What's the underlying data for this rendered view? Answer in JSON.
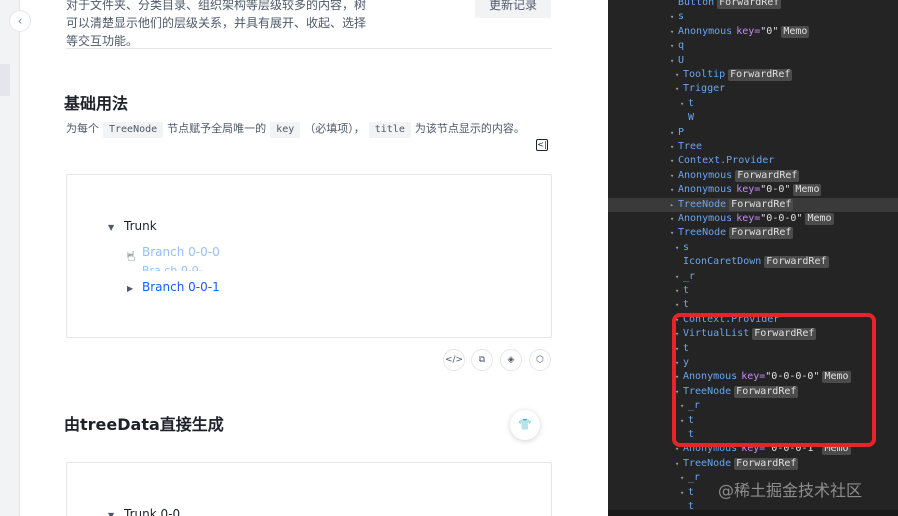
{
  "left_nav": {
    "collapse_icon": "chevron-left-icon",
    "collapse_glyph": "‹"
  },
  "doc": {
    "intro": "对于文件夹、分类目录、组织架构等层级较多的内容，树可以清楚显示他们的层级关系，并具有展开、收起、选择等交互功能。",
    "changelog_label": "更新记录",
    "section1": {
      "title": "基础用法",
      "desc_1": "为每个",
      "code_1": "TreeNode",
      "desc_2": "节点赋予全局唯一的",
      "code_2": "key",
      "desc_3": "（必填项），",
      "code_3": "title",
      "desc_4": "为该节点显示的内容。",
      "demo": {
        "root_label": "Trunk",
        "branch_1": "Branch 0-0-0",
        "branch_1_overlap": "Bra ch 0-0-",
        "branch_2": "Branch 0-0-1"
      },
      "toolbar_icons": [
        "code-icon",
        "copy-icon",
        "codepen-icon",
        "codesandbox-icon"
      ],
      "toolbar_glyphs": [
        "</>",
        "⧉",
        "◈",
        "⬡"
      ]
    },
    "section2": {
      "title": "由treeData直接生成",
      "demo_root_label": "Trunk 0-0"
    },
    "float_icon": "shirt-icon",
    "float_glyph": "👕",
    "expand_code_glyph": "<|"
  },
  "devtools": {
    "rows": [
      {
        "indent": 0,
        "arrow": "",
        "name": "Button",
        "badges": [
          "ForwardRef"
        ]
      },
      {
        "indent": 0,
        "arrow": "▾",
        "name": "s",
        "badges": []
      },
      {
        "indent": 0,
        "arrow": "▾",
        "name": "Anonymous",
        "key": "\"0\"",
        "badges": [
          "Memo"
        ]
      },
      {
        "indent": 0,
        "arrow": "▾",
        "name": "q",
        "badges": []
      },
      {
        "indent": 0,
        "arrow": "▾",
        "name": "U",
        "badges": []
      },
      {
        "indent": 1,
        "arrow": "▾",
        "name": "Tooltip",
        "badges": [
          "ForwardRef"
        ]
      },
      {
        "indent": 1,
        "arrow": "▾",
        "name": "Trigger",
        "badges": []
      },
      {
        "indent": 2,
        "arrow": "▾",
        "name": "t",
        "badges": []
      },
      {
        "indent": 2,
        "arrow": "",
        "name": "W",
        "badges": []
      },
      {
        "indent": 0,
        "arrow": "▾",
        "name": "P",
        "badges": []
      },
      {
        "indent": 0,
        "arrow": "▾",
        "name": "Tree",
        "badges": []
      },
      {
        "indent": 0,
        "arrow": "▾",
        "name": "Context.Provider",
        "badges": []
      },
      {
        "indent": 0,
        "arrow": "▾",
        "name": "Anonymous",
        "badges": [
          "ForwardRef"
        ]
      },
      {
        "indent": 0,
        "arrow": "▾",
        "name": "Anonymous",
        "key": "\"0-0\"",
        "badges": [
          "Memo"
        ]
      },
      {
        "indent": 0,
        "arrow": "▸",
        "name": "TreeNode",
        "badges": [
          "ForwardRef"
        ],
        "selected": true
      },
      {
        "indent": 0,
        "arrow": "▾",
        "name": "Anonymous",
        "key": "\"0-0-0\"",
        "badges": [
          "Memo"
        ]
      },
      {
        "indent": 0,
        "arrow": "▾",
        "name": "TreeNode",
        "badges": [
          "ForwardRef"
        ]
      },
      {
        "indent": 1,
        "arrow": "▾",
        "name": "s",
        "badges": []
      },
      {
        "indent": 1,
        "arrow": "",
        "name": "IconCaretDown",
        "badges": [
          "ForwardRef"
        ]
      },
      {
        "indent": 1,
        "arrow": "▾",
        "name": "_r",
        "badges": []
      },
      {
        "indent": 1,
        "arrow": "▾",
        "name": "t",
        "badges": []
      },
      {
        "indent": 1,
        "arrow": "▾",
        "name": "t",
        "badges": []
      },
      {
        "indent": 1,
        "arrow": "▾",
        "name": "Context.Provider",
        "badges": []
      },
      {
        "indent": 1,
        "arrow": "▾",
        "name": "VirtualList",
        "badges": [
          "ForwardRef"
        ]
      },
      {
        "indent": 1,
        "arrow": "▾",
        "name": "t",
        "badges": []
      },
      {
        "indent": 1,
        "arrow": "▾",
        "name": "y",
        "badges": []
      },
      {
        "indent": 1,
        "arrow": "▾",
        "name": "Anonymous",
        "key": "\"0-0-0-0\"",
        "badges": [
          "Memo"
        ]
      },
      {
        "indent": 1,
        "arrow": "▾",
        "name": "TreeNode",
        "badges": [
          "ForwardRef"
        ]
      },
      {
        "indent": 2,
        "arrow": "▾",
        "name": "_r",
        "badges": []
      },
      {
        "indent": 2,
        "arrow": "▾",
        "name": "t",
        "badges": []
      },
      {
        "indent": 2,
        "arrow": "",
        "name": "t",
        "badges": []
      },
      {
        "indent": 1,
        "arrow": "▾",
        "name": "Anonymous",
        "key": "\"0-0-0-1\"",
        "badges": [
          "Memo"
        ]
      },
      {
        "indent": 1,
        "arrow": "▾",
        "name": "TreeNode",
        "badges": [
          "ForwardRef"
        ]
      },
      {
        "indent": 2,
        "arrow": "▾",
        "name": "_r",
        "badges": []
      },
      {
        "indent": 2,
        "arrow": "▾",
        "name": "t",
        "badges": []
      },
      {
        "indent": 2,
        "arrow": "",
        "name": "t",
        "badges": []
      }
    ]
  },
  "watermark": "@稀土掘金技术社区",
  "colors": {
    "link_blue": "#165dff",
    "link_blue_faded": "#94bfff",
    "devtools_bg": "#242424",
    "highlight_red": "#e8242b",
    "component_name": "#6aa5f0",
    "prop_key": "#c38df5"
  }
}
